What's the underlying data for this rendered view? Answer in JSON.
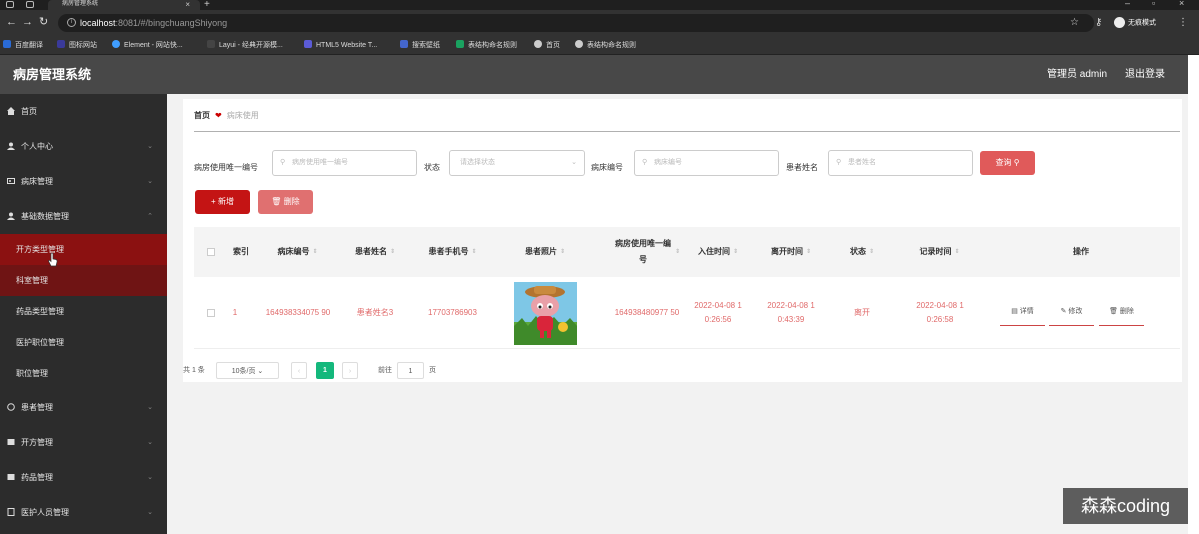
{
  "browser": {
    "tab_title": "病房管理系统",
    "url_host": "localhost",
    "url_path": ":8081/#/bingchuangShiyong",
    "profile_label": "无痕模式",
    "bookmarks": [
      "百度翻译",
      "图标网站",
      "Element - 网站快...",
      "Layui - 经典开源模...",
      "HTML5 Website T...",
      "搜索壁纸",
      "表结构命名规则",
      "首页",
      "表结构命名规则"
    ]
  },
  "header": {
    "title": "病房管理系统",
    "admin_label": "管理员 admin",
    "logout_label": "退出登录"
  },
  "sidebar": {
    "items": [
      {
        "label": "首页",
        "icon": "home-icon"
      },
      {
        "label": "个人中心",
        "icon": "user-icon"
      },
      {
        "label": "病床管理",
        "icon": "bed-icon"
      },
      {
        "label": "基础数据管理",
        "icon": "data-icon"
      }
    ],
    "sub_items": [
      "开方类型管理",
      "科室管理",
      "药品类型管理",
      "医护职位管理",
      "职位管理"
    ],
    "items_after": [
      {
        "label": "患者管理",
        "icon": "patient-icon"
      },
      {
        "label": "开方管理",
        "icon": "prescription-icon"
      },
      {
        "label": "药品管理",
        "icon": "drug-icon"
      },
      {
        "label": "医护人员管理",
        "icon": "staff-icon"
      }
    ]
  },
  "breadcrumb": {
    "home": "首页",
    "current": "病床使用"
  },
  "filters": {
    "f1_label": "病房使用唯一编号",
    "f1_placeholder": "病房使用唯一编号",
    "f2_label": "状态",
    "f2_placeholder": "请选择状态",
    "f3_label": "病床编号",
    "f3_placeholder": "病床编号",
    "f4_label": "患者姓名",
    "f4_placeholder": "患者姓名",
    "query_label": "查询"
  },
  "actions": {
    "add_label": "新增",
    "delete_label": "删除"
  },
  "table": {
    "columns": [
      "索引",
      "病床编号",
      "患者姓名",
      "患者手机号",
      "患者照片",
      "病房使用唯一编号",
      "入住时间",
      "离开时间",
      "状态",
      "记录时间",
      "操作"
    ],
    "rows": [
      {
        "index": "1",
        "bed_no": "164938334075 90",
        "patient_name": "患者姓名3",
        "phone": "17703786903",
        "usage_no": "164938480977 50",
        "checkin": "2022-04-08 1 0:26:56",
        "checkout": "2022-04-08 1 0:43:39",
        "status": "离开",
        "record_time": "2022-04-08 1 0:26:58",
        "op_detail": "详情",
        "op_edit": "修改",
        "op_delete": "删除"
      }
    ]
  },
  "pager": {
    "total": "共 1 条",
    "page_size": "10条/页",
    "current_page": "1",
    "goto_label": "前往",
    "goto_value": "1",
    "page_unit": "页"
  },
  "watermark": "森森coding",
  "colors": {
    "accent": "#c41414",
    "sidebar_bg": "#2c2c2c",
    "header_bg": "#484848",
    "active_page": "#14b87c"
  }
}
